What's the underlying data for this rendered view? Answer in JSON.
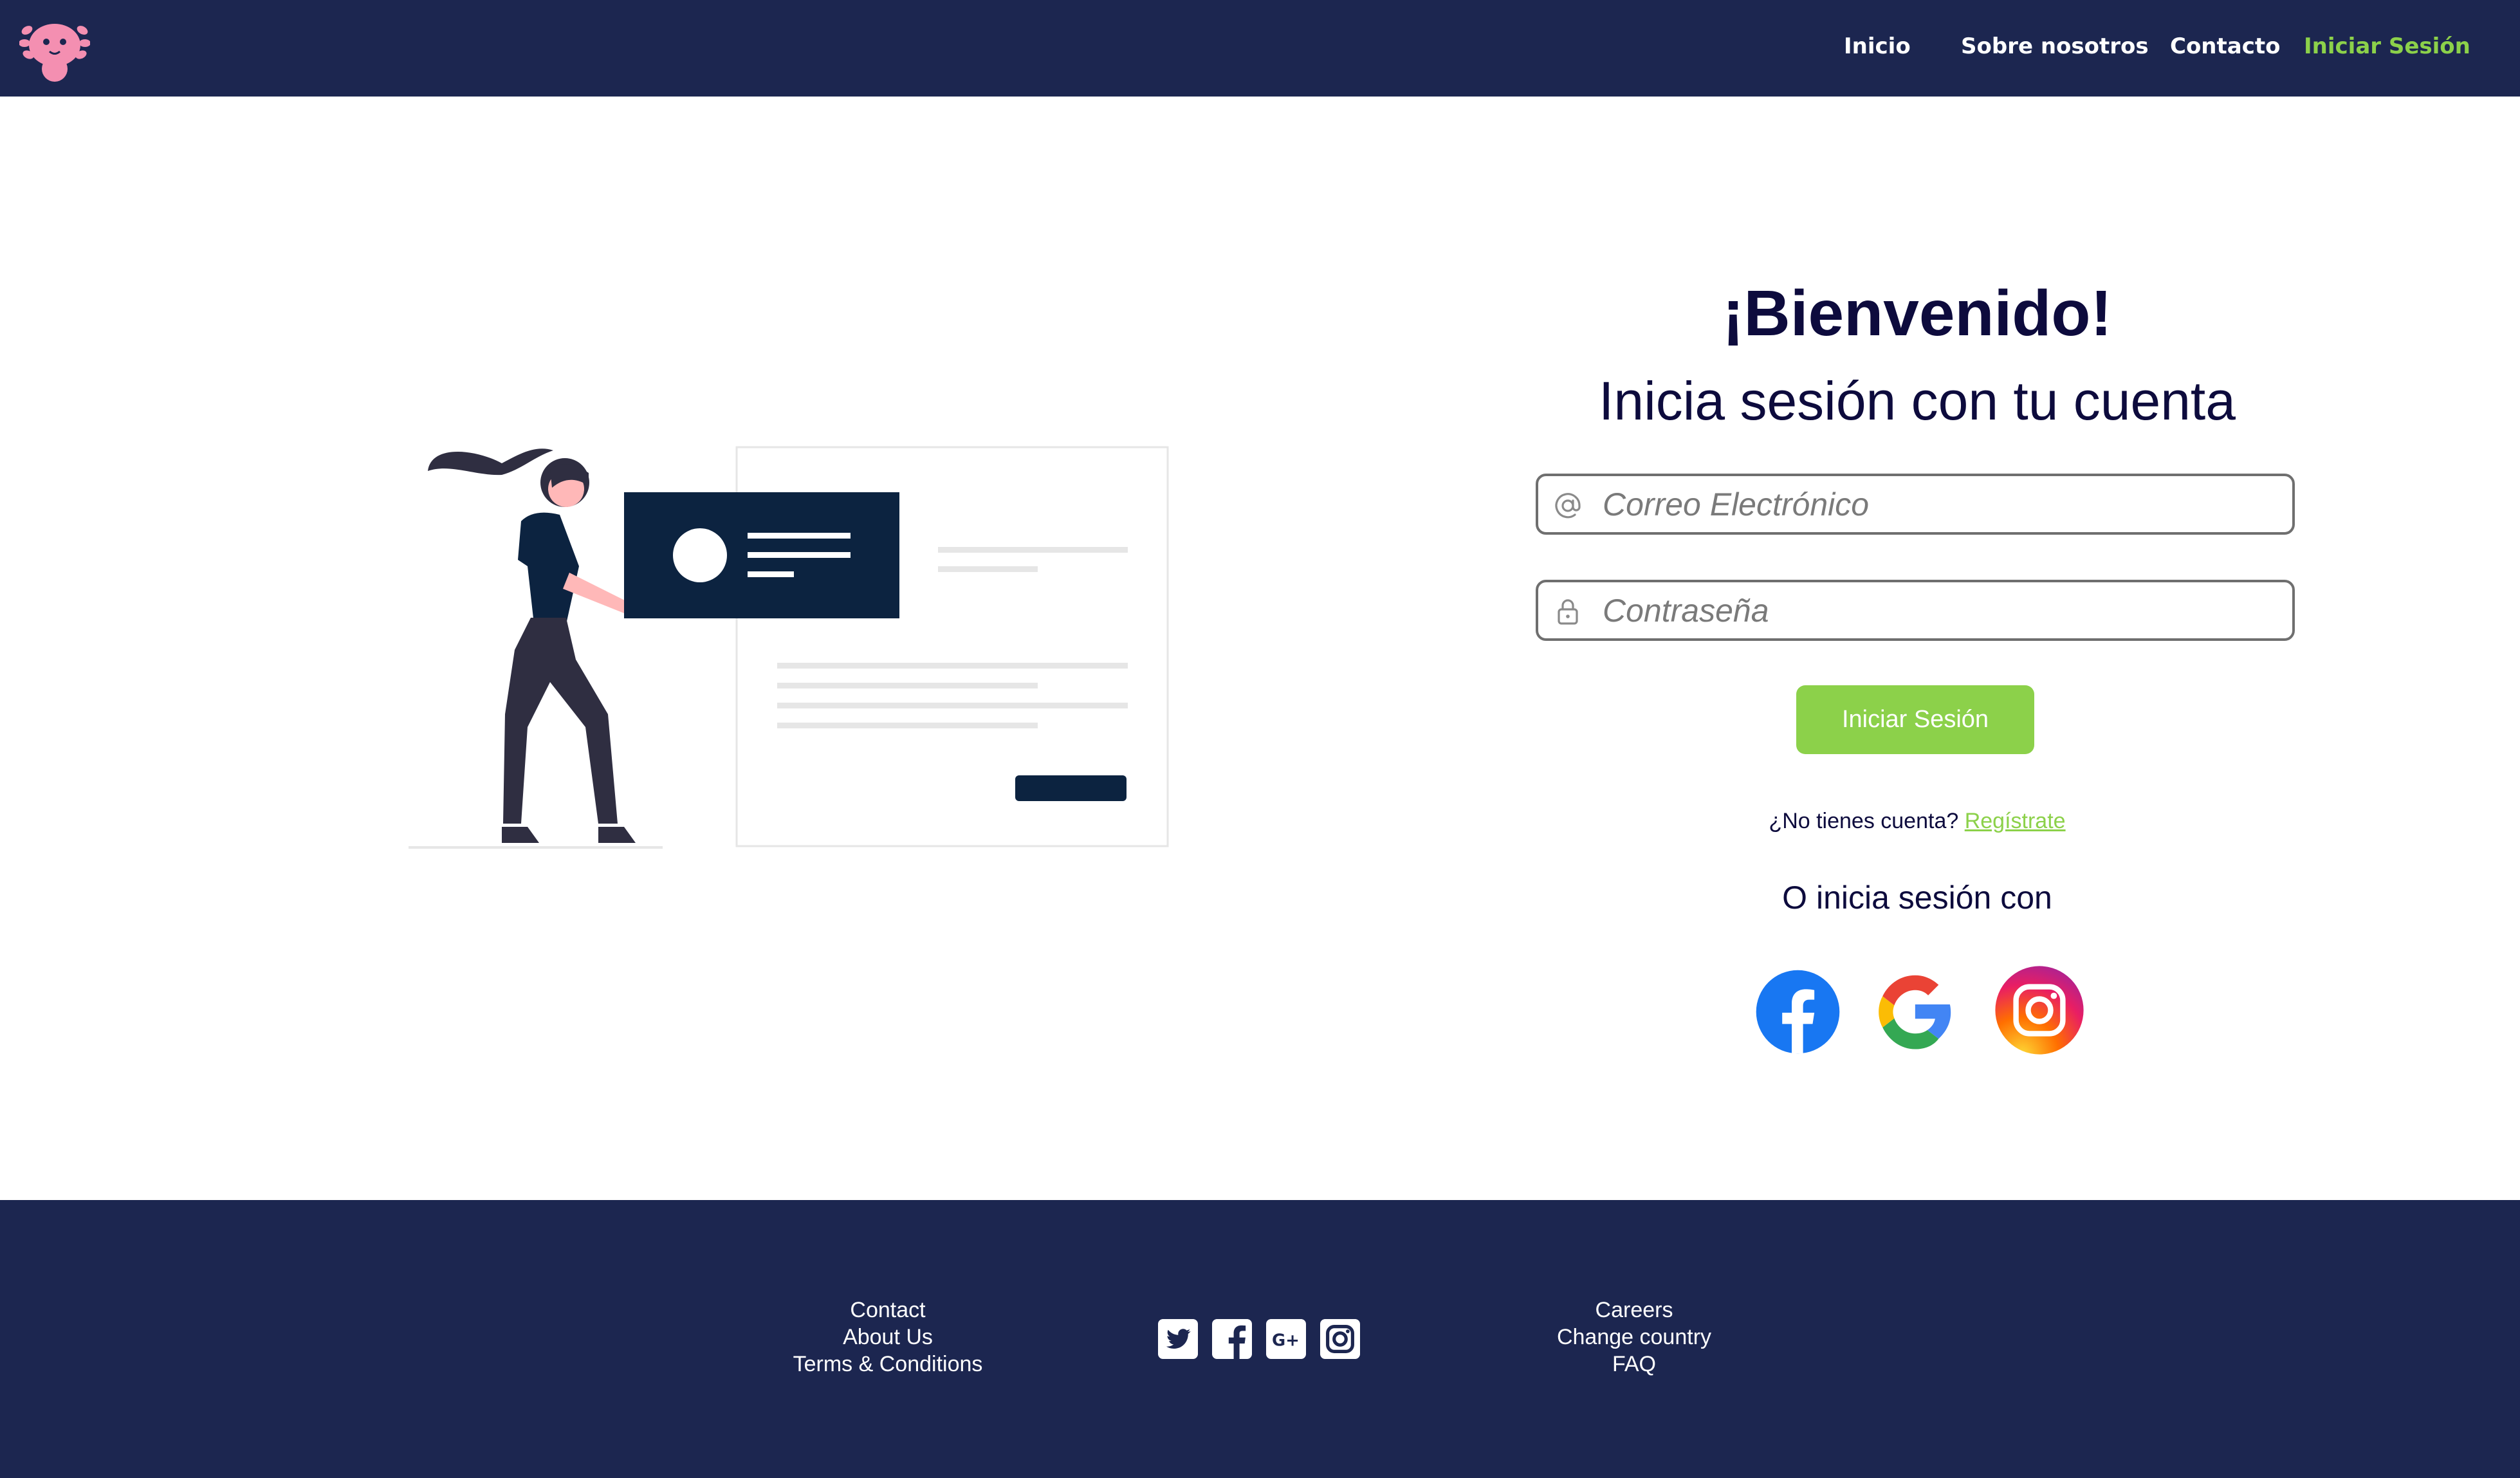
{
  "nav": {
    "links": [
      {
        "label": "Inicio"
      },
      {
        "label": "Sobre nosotros"
      },
      {
        "label": "Contacto"
      },
      {
        "label": "Iniciar Sesión",
        "active": true
      }
    ]
  },
  "login": {
    "title": "¡Bienvenido!",
    "subtitle": "Inicia sesión con tu cuenta",
    "email_placeholder": "Correo Electrónico",
    "email_value": "",
    "password_placeholder": "Contraseña",
    "password_value": "",
    "submit_label": "Iniciar  Sesión",
    "no_account_text": "¿No tienes cuenta?",
    "register_link": "Regístrate",
    "or_text": "O inicia sesión con",
    "social": [
      "facebook-icon",
      "google-icon",
      "instagram-icon"
    ]
  },
  "footer": {
    "col1": [
      "Contact",
      "About Us",
      "Terms & Conditions"
    ],
    "icons": [
      "twitter-icon",
      "facebook-icon",
      "google-plus-icon",
      "instagram-icon"
    ],
    "col2": [
      "Careers",
      "Change country",
      "FAQ"
    ]
  },
  "colors": {
    "navy": "#1c2650",
    "accent": "#8cd14a",
    "heading": "#0d0b3d"
  }
}
